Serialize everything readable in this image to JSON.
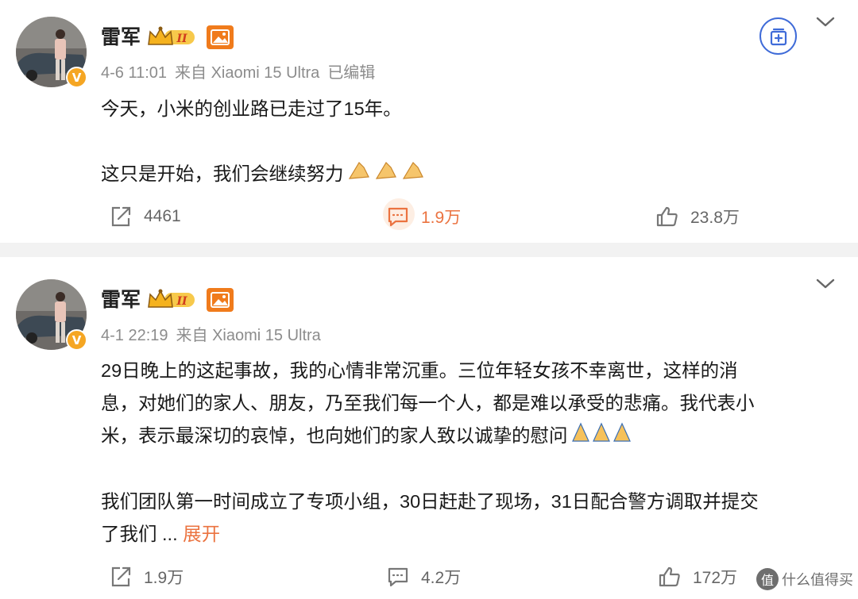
{
  "posts": [
    {
      "author": "雷军",
      "level_badge": "II",
      "verified_mark": "V",
      "date": "4-6 11:01",
      "source": "来自 Xiaomi 15 Ultra",
      "edited": "已编辑",
      "paragraphs": [
        "今天，小米的创业路已走过了15年。",
        "",
        "这只是开始，我们会继续努力"
      ],
      "emoji": "hands-emoji x3",
      "repost_count": "4461",
      "comment_count": "1.9万",
      "like_count": "23.8万"
    },
    {
      "author": "雷军",
      "level_badge": "II",
      "verified_mark": "V",
      "date": "4-1 22:19",
      "source": "来自 Xiaomi 15 Ultra",
      "paragraphs": [
        "29日晚上的这起事故，我的心情非常沉重。三位年轻女孩不幸离世，这样的消",
        "息，对她们的家人、朋友，乃至我们每一个人，都是难以承受的悲痛。我代表小",
        "米，表示最深切的哀悼，也向她们的家人致以诚挚的慰问",
        "",
        "我们团队第一时间成立了专项小组，30日赶赴了现场，31日配合警方调取并提交",
        "了我们"
      ],
      "ellipsis": " ...",
      "expand_label": "展开",
      "emoji": "praying-hands-emoji x3",
      "repost_count": "1.9万",
      "comment_count": "4.2万",
      "like_count": "172万"
    }
  ],
  "watermark": {
    "logo": "值",
    "text": "什么值得买"
  },
  "colors": {
    "accent": "#eb7340",
    "follow_blue": "#3f6bd8",
    "badge_orange": "#f07b1c",
    "divider": "#f2f2f2"
  }
}
